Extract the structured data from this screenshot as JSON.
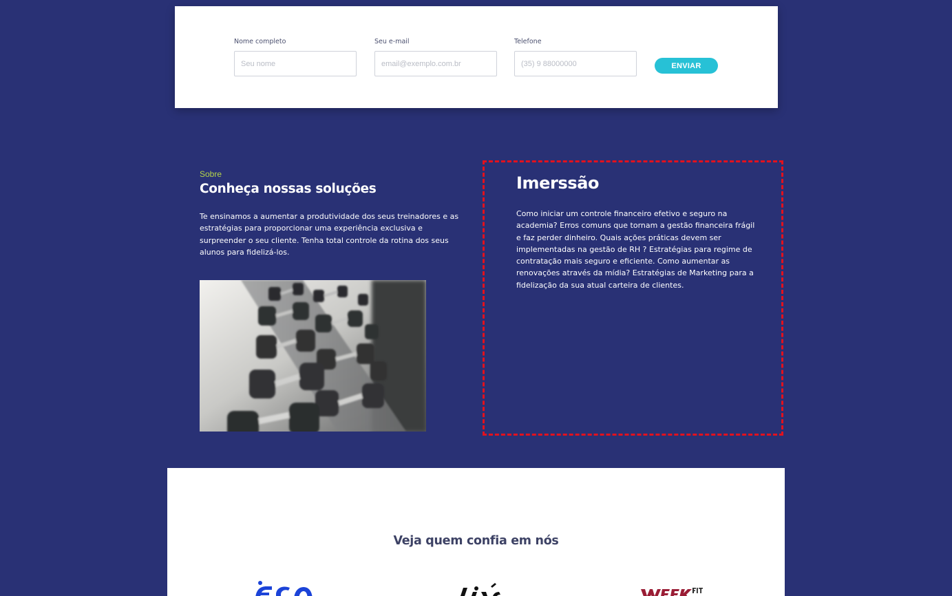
{
  "form": {
    "name_label": "Nome completo",
    "name_placeholder": "Seu nome",
    "email_label": "Seu e-mail",
    "email_placeholder": "email@exemplo.com.br",
    "phone_label": "Telefone",
    "phone_placeholder": "(35) 9 88000000",
    "submit_label": "ENVIAR"
  },
  "about": {
    "eyebrow": "Sobre",
    "title": "Conheça nossas soluções",
    "text": "Te ensinamos a aumentar a produtividade dos seus treinadores e as estratégias para proporcionar uma experiência exclusiva e surpreender o seu cliente. Tenha total controle da rotina dos seus alunos para fidelizá-los.",
    "image": "dumbbell-rack-photo"
  },
  "immersion": {
    "title": "Imerssão",
    "text": "Como iniciar um controle financeiro efetivo e seguro na academia? Erros comuns que tornam a gestão financeira frágil e faz perder dinheiro. Quais ações práticas devem ser implementadas na gestão de RH ? Estratégias para regime de contratação mais seguro e eficiente. Como aumentar as renovações através da mídia? Estratégias de Marketing para a fidelização da sua atual carteira de clientes."
  },
  "trust": {
    "title": "Veja quem confia em nós",
    "logos": [
      "eco-logo",
      "live-logo",
      "weekfit-logo"
    ]
  },
  "colors": {
    "background": "#293175",
    "accent": "#27c1d6",
    "eyebrow": "#b6d64a",
    "dashed_border": "#e3111d"
  }
}
